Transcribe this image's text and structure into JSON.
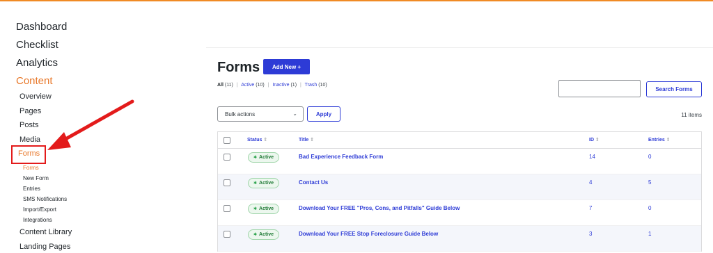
{
  "sidebar": {
    "top_items": [
      "Dashboard",
      "Checklist",
      "Analytics",
      "Content"
    ],
    "content_items": [
      "Overview",
      "Pages",
      "Posts",
      "Media",
      "Forms"
    ],
    "forms_subitems": [
      "Forms",
      "New Form",
      "Entries",
      "SMS Notifications",
      "Import/Export",
      "Integrations"
    ],
    "bottom_items": [
      "Content Library",
      "Landing Pages"
    ]
  },
  "header": {
    "title": "Forms",
    "add_new_label": "Add New +"
  },
  "filters": {
    "all": "All",
    "all_count": "(11)",
    "active": "Active",
    "active_count": "(10)",
    "inactive": "Inactive",
    "inactive_count": "(1)",
    "trash": "Trash",
    "trash_count": "(10)"
  },
  "search": {
    "value": "",
    "button_label": "Search Forms"
  },
  "bulk": {
    "selected": "Bulk actions",
    "apply_label": "Apply",
    "items_count": "11 items"
  },
  "table": {
    "columns": [
      "Status",
      "Title",
      "ID",
      "Entries"
    ],
    "rows": [
      {
        "status": "Active",
        "title": "Bad Experience Feedback Form",
        "id": "14",
        "entries": "0"
      },
      {
        "status": "Active",
        "title": "Contact Us",
        "id": "4",
        "entries": "5"
      },
      {
        "status": "Active",
        "title": "Download Your FREE \"Pros, Cons, and Pitfalls\" Guide Below",
        "id": "7",
        "entries": "0"
      },
      {
        "status": "Active",
        "title": "Download Your FREE Stop Foreclosure Guide Below",
        "id": "3",
        "entries": "1"
      }
    ]
  },
  "colors": {
    "accent_orange": "#e8782a",
    "primary_blue": "#2d3bd6",
    "highlight_red": "#e31b1b",
    "active_green": "#1f7a36"
  }
}
